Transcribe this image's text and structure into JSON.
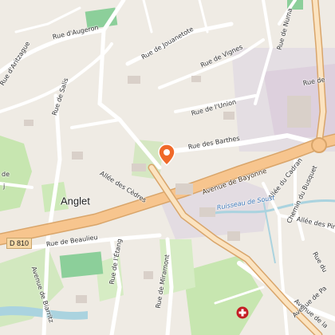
{
  "map": {
    "place_label": "Anglet",
    "road_shield": "D 810",
    "water_label": "Ruisseau de Soust",
    "street_labels": [
      "Rue d'Augeron",
      "Rue d'Aritzague",
      "Rue de Salis",
      "Rue de Jouanetote",
      "Rue de Vignes",
      "Rue de l'Union",
      "Rue des Barthes",
      "Rue de Numa",
      "Avenue de Bayonne",
      "Allée des Cèdres",
      "Allée du Cadran",
      "Chemin du Busquet",
      "Allée des Pins",
      "Rue de Beaulieu",
      "Rue de l'Étang",
      "Rue de Miramont",
      "Avenue de Biarritz",
      "Avenue de Pa",
      "Avenue de la"
    ],
    "edge_fragments": [
      "Rue de",
      "Rue du",
      "de",
      "j"
    ],
    "icons": {
      "pin": "location-pin-icon",
      "hospital": "hospital-icon"
    },
    "colors": {
      "background": "#f2efe9",
      "main_road": "#f7c58e",
      "main_road_casing": "#d9a56a",
      "street": "#ffffff",
      "park": "#c7e6b0",
      "sports": "#8ccf9a",
      "water": "#aad3df",
      "industrial": "#dfd3df",
      "pin": "#f06a2a"
    }
  }
}
